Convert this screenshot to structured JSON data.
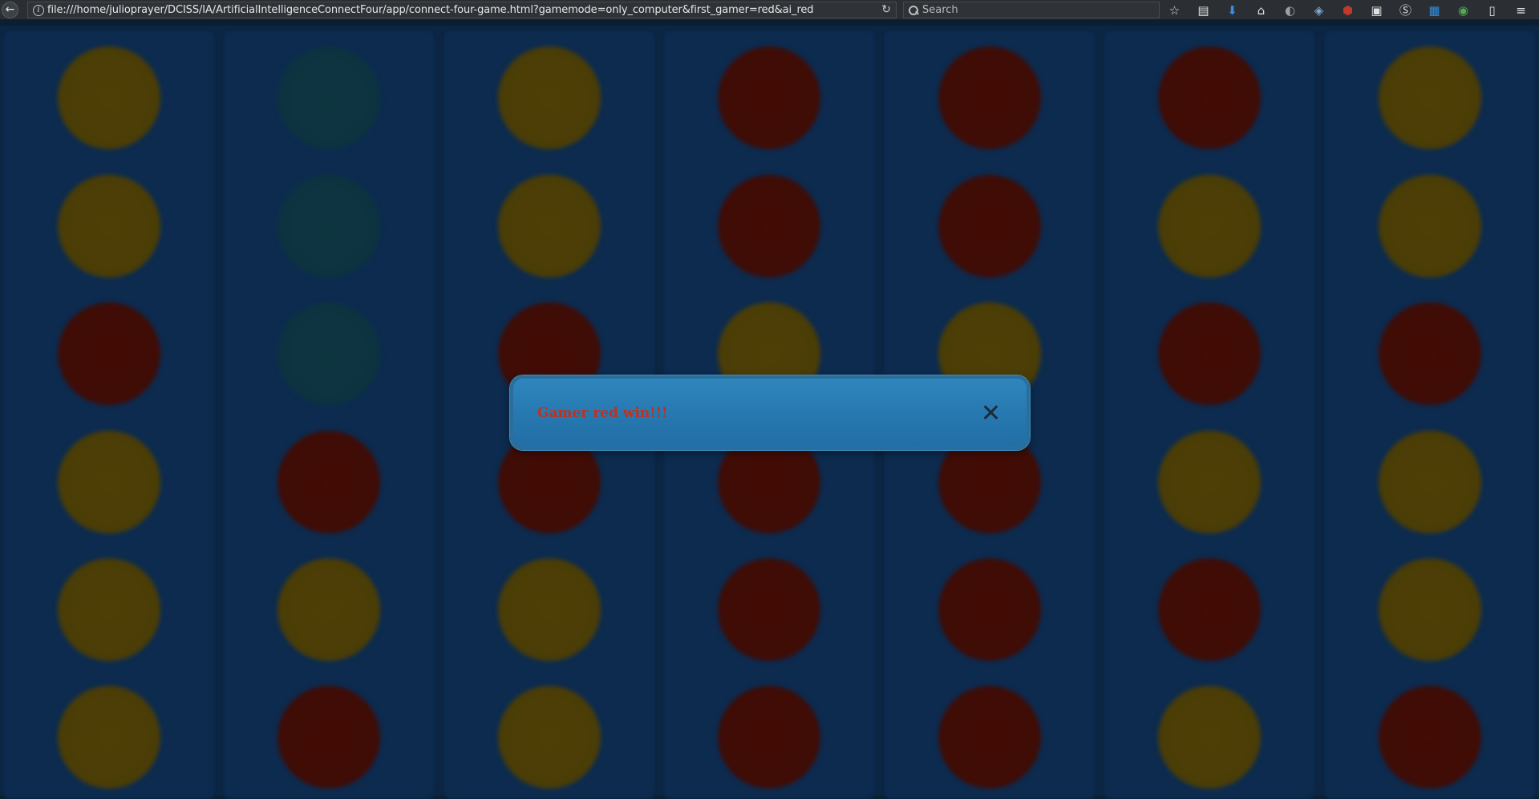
{
  "browser": {
    "url": "file:///home/julioprayer/DCISS/IA/ArtificialIntelligenceConnectFour/app/connect-four-game.html?gamemode=only_computer&first_gamer=red&ai_red",
    "search_placeholder": "Search",
    "toolbar_icons": [
      "star-icon",
      "reading-list-icon",
      "download-icon",
      "home-icon",
      "extension-icon",
      "extension-icon",
      "ublock-icon",
      "image-icon",
      "s-extension-icon",
      "s-extension-icon",
      "sync-icon",
      "page-icon",
      "menu-icon"
    ]
  },
  "board": {
    "columns": [
      [
        "yellow",
        "yellow",
        "red",
        "yellow",
        "yellow",
        "yellow"
      ],
      [
        "empty",
        "empty",
        "empty",
        "red",
        "yellow",
        "red"
      ],
      [
        "yellow",
        "yellow",
        "red",
        "red",
        "yellow",
        "yellow"
      ],
      [
        "red",
        "red",
        "yellow",
        "red",
        "red",
        "red"
      ],
      [
        "red",
        "red",
        "yellow",
        "red",
        "red",
        "red"
      ],
      [
        "red",
        "yellow",
        "red",
        "yellow",
        "red",
        "yellow"
      ],
      [
        "yellow",
        "yellow",
        "red",
        "yellow",
        "yellow",
        "red"
      ]
    ],
    "colors": {
      "yellow": "#4d3f05",
      "red": "#430c05",
      "empty": "#0d3540",
      "column": "#0c2b4f"
    }
  },
  "dialog": {
    "message": "Gamer red win!!!",
    "message_color": "#c0301f"
  }
}
